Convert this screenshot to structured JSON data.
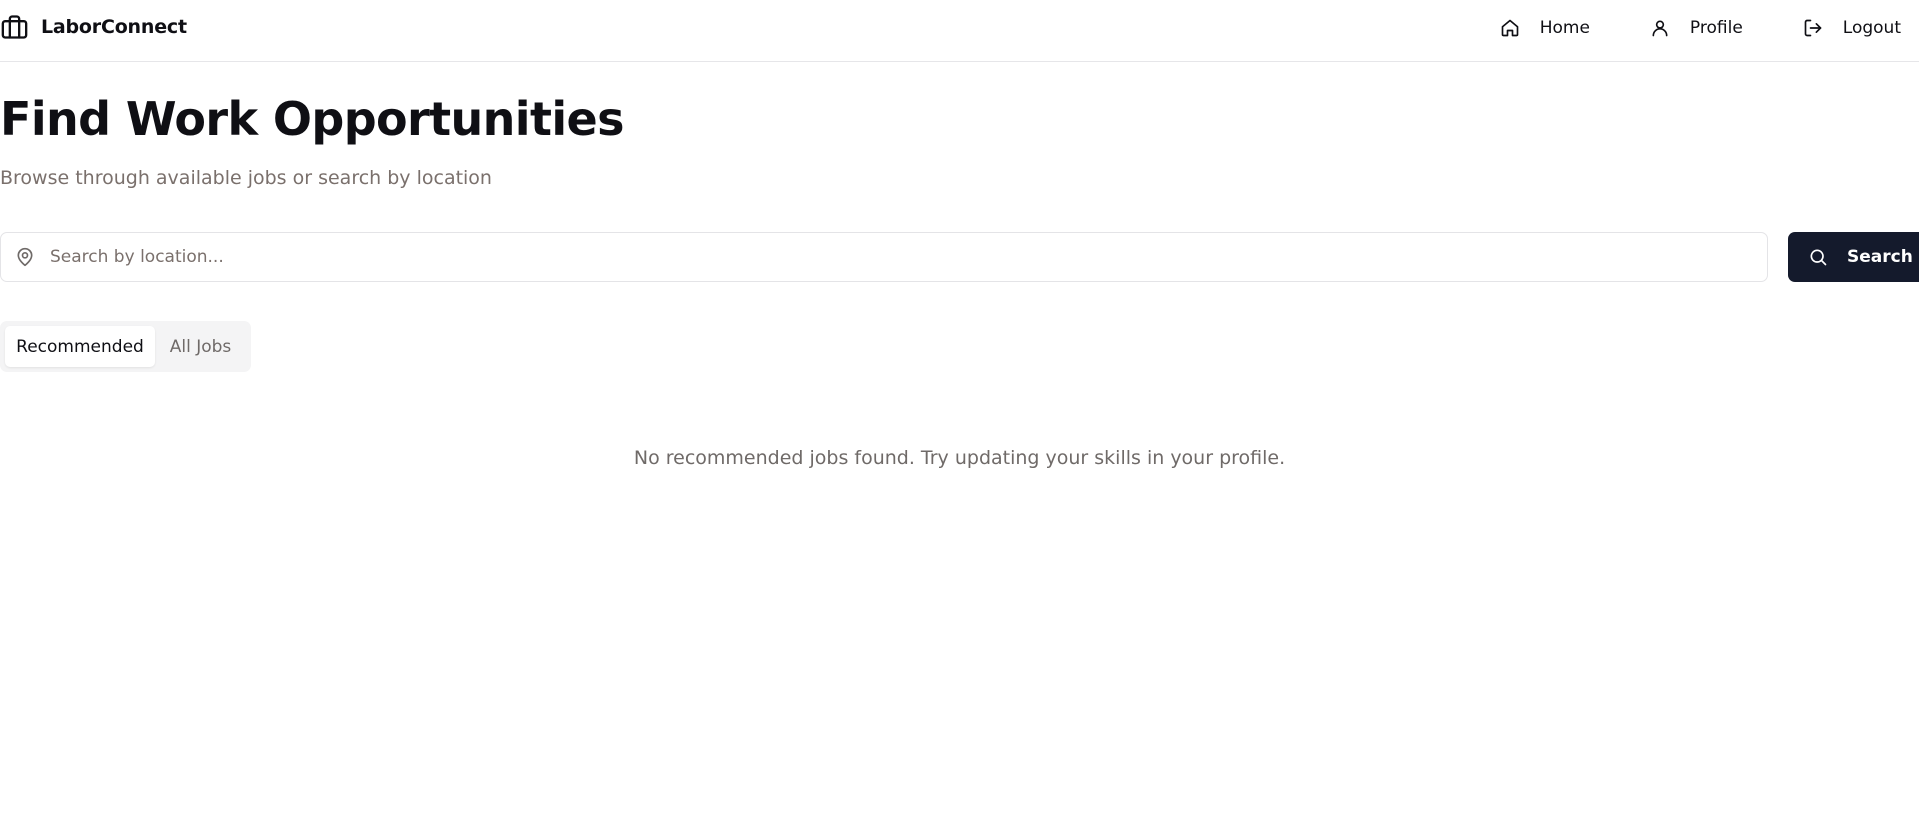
{
  "app": {
    "brand": "LaborConnect",
    "brand_icon": "briefcase-icon"
  },
  "nav": {
    "home": {
      "label": "Home",
      "icon": "home-icon"
    },
    "profile": {
      "label": "Profile",
      "icon": "user-icon"
    },
    "logout": {
      "label": "Logout",
      "icon": "logout-icon"
    }
  },
  "page": {
    "title": "Find Work Opportunities",
    "subtitle": "Browse through available jobs or search by location"
  },
  "search": {
    "placeholder": "Search by location...",
    "value": "",
    "button_label": "Search",
    "input_icon": "map-pin-icon",
    "button_icon": "search-icon"
  },
  "tabs": [
    {
      "label": "Recommended",
      "active": true
    },
    {
      "label": "All Jobs",
      "active": false
    }
  ],
  "results": {
    "empty_message": "No recommended jobs found. Try updating your skills in your profile."
  },
  "colors": {
    "primary_button": "#141a2c",
    "muted_text": "#7a706c",
    "border": "#e4e4e7",
    "tab_background": "#f4f4f5"
  }
}
